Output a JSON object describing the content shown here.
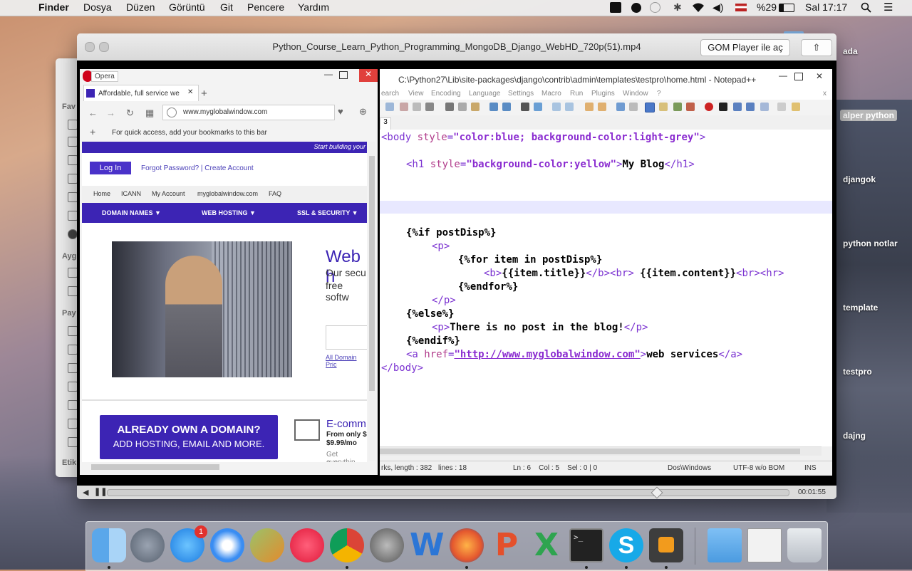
{
  "menubar": {
    "app": "Finder",
    "items": [
      "Dosya",
      "Düzen",
      "Görüntü",
      "Git",
      "Pencere",
      "Yardım"
    ],
    "battery": "%29",
    "clock": "Sal 17:17"
  },
  "desktop": {
    "labels": [
      "ada",
      "alper python",
      "djangok",
      "python notlar",
      "template",
      "testpro",
      "dajng"
    ]
  },
  "finder_sidebar": {
    "sections": [
      "Fav",
      "Ayg",
      "Pay",
      "Etik"
    ]
  },
  "player": {
    "title": "Python_Course_Learn_Python_Programming_MongoDB_Django_WebHD_720p(51).mp4",
    "open_with": "GOM Player ile aç",
    "time": "00:01:55",
    "progress": 0.8
  },
  "opera": {
    "brand": "Opera",
    "tab_title": "Affordable, full service we",
    "url": "www.myglobalwindow.com",
    "bookmarks_hint": "For quick access, add your bookmarks to this bar",
    "site": {
      "banner": "Start building your",
      "login": "Log In",
      "forgot": "Forgot Password? | Create Account",
      "links": [
        "Home",
        "ICANN",
        "My Account",
        "myglobalwindow.com",
        "FAQ"
      ],
      "nav": [
        "DOMAIN NAMES ▼",
        "WEB HOSTING ▼",
        "SSL & SECURITY ▼"
      ],
      "hero_title": "Web h",
      "hero_text1": "Our secu",
      "hero_text2": "free softw",
      "domain_link": "All Domain Pric",
      "cta1": "ALREADY OWN A DOMAIN?",
      "cta2": "ADD HOSTING, EMAIL AND MORE.",
      "ecom_title": "E-comm",
      "ecom_from": "From only $",
      "ecom_price": "$9.99/mo",
      "ecom_more": "Get everythin"
    }
  },
  "notepad": {
    "title": "C:\\Python27\\Lib\\site-packages\\django\\contrib\\admin\\templates\\testpro\\home.html - Notepad++",
    "menu": [
      "earch",
      "View",
      "Encoding",
      "Language",
      "Settings",
      "Macro",
      "Run",
      "Plugins",
      "Window",
      "?"
    ],
    "tab_no": "3",
    "code": {
      "l1_open": "<body ",
      "l1_attr": "style",
      "l1_eq": "=",
      "l1_val": "\"color:blue; background-color:light-grey\"",
      "l1_close": ">",
      "l2_open": "<h1 ",
      "l2_attr": "style",
      "l2_eq": "=",
      "l2_val": "\"background-color:yellow\"",
      "l2_gt": ">",
      "l2_text": "My Blog",
      "l2_end": "</h1>",
      "l3": "{%if postDisp%}",
      "l4": "<p>",
      "l5": "{%for item in postDisp%}",
      "l6_b": "<b>",
      "l6_t": "{{item.title}}",
      "l6_e": "</b><br>",
      "l6_c": " {{item.content}}",
      "l6_f": "<br><hr>",
      "l7": "{%endfor%}",
      "l8": "</p>",
      "l9": "{%else%}",
      "l10_p": "<p>",
      "l10_t": "There is no post in the blog!",
      "l10_e": "</p>",
      "l11": "{%endif%}",
      "l12_a": "<a ",
      "l12_attr": "href",
      "l12_eq": "=",
      "l12_val": "\"http://www.myglobalwindow.com\"",
      "l12_gt": ">",
      "l12_text": "web services",
      "l12_end": "</a>",
      "l13": "</body>"
    },
    "status": {
      "length": "rks, length : 382",
      "lines": "lines : 18",
      "pos": "Ln : 6    Col : 5    Sel : 0 | 0",
      "eol": "Dos\\Windows",
      "enc": "UTF-8 w/o BOM",
      "mode": "INS"
    }
  },
  "dock": {
    "badge": "1",
    "apps": [
      "finder-icon",
      "launchpad-icon",
      "app-store-icon",
      "safari-icon",
      "mirror-icon",
      "itunes-icon",
      "chrome-icon",
      "system-preferences-icon",
      "word-icon",
      "firefox-icon",
      "powerpoint-icon",
      "excel-icon",
      "terminal-icon",
      "skype-icon",
      "sublime-icon",
      "folder-icon",
      "preview-icon",
      "trash-icon"
    ]
  }
}
